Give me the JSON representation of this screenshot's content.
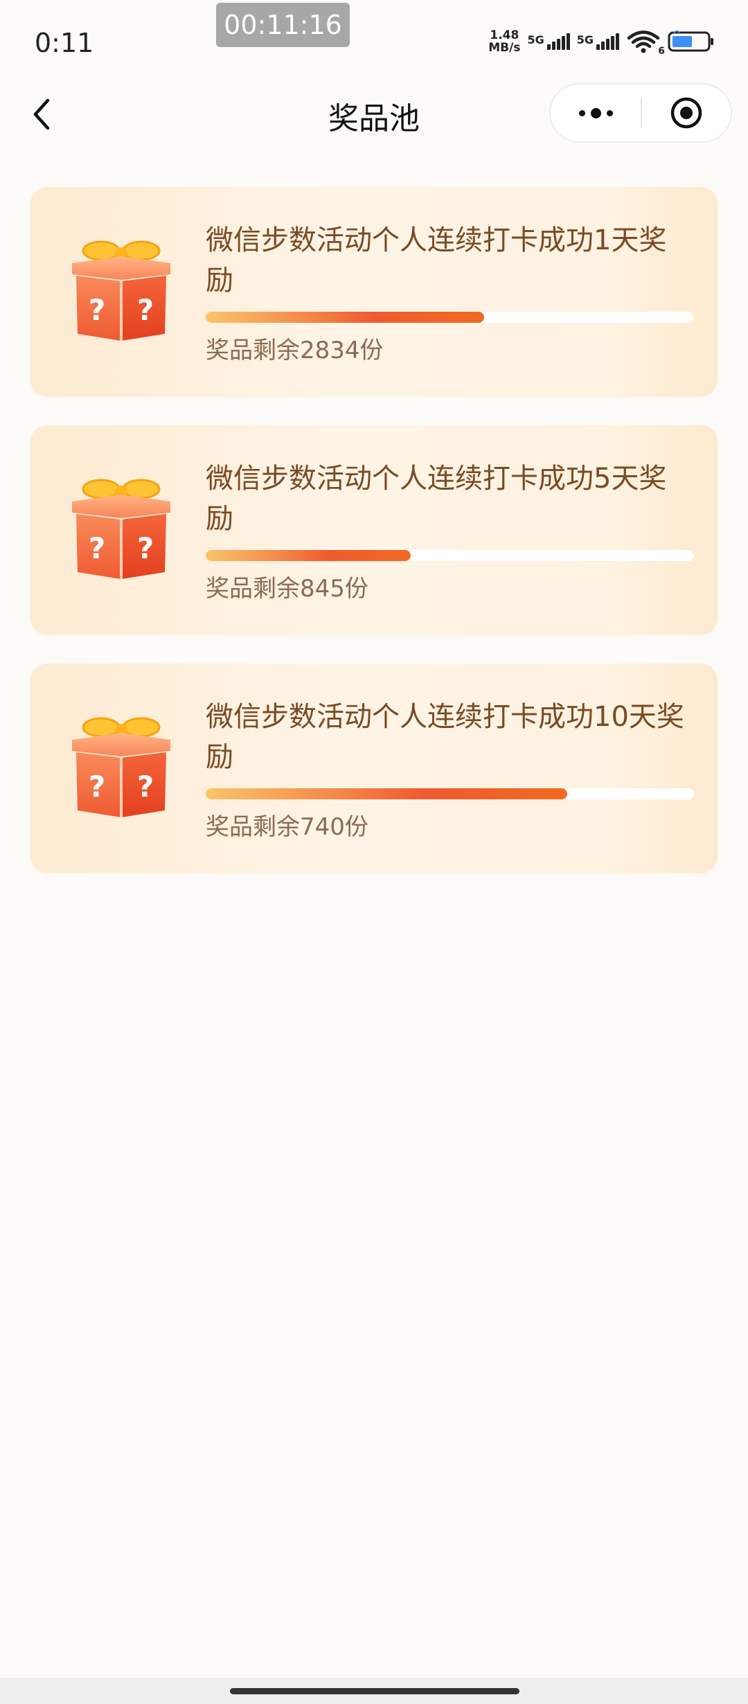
{
  "status_bar": {
    "time": "0:11",
    "timer": "00:11:16",
    "net_speed_value": "1.48",
    "net_speed_unit": "MB/s",
    "sim1_label": "5G",
    "sim2_label": "5G",
    "wifi_badge": "6"
  },
  "nav": {
    "title": "奖品池"
  },
  "prizes": [
    {
      "title": "微信步数活动个人连续打卡成功1天奖励",
      "remaining": "奖品剩余2834份",
      "progress": 0.57
    },
    {
      "title": "微信步数活动个人连续打卡成功5天奖励",
      "remaining": "奖品剩余845份",
      "progress": 0.42
    },
    {
      "title": "微信步数活动个人连续打卡成功10天奖励",
      "remaining": "奖品剩余740份",
      "progress": 0.74
    }
  ],
  "colors": {
    "title_text": "#7a4a24",
    "remaining_text": "#8c6a52",
    "progress_start": "#f9c56b",
    "progress_end": "#f06a22"
  },
  "icons": {
    "back": "chevron-left-icon",
    "more": "more-dots-icon",
    "close": "target-circle-icon",
    "gift": "mystery-gift-box-icon"
  }
}
